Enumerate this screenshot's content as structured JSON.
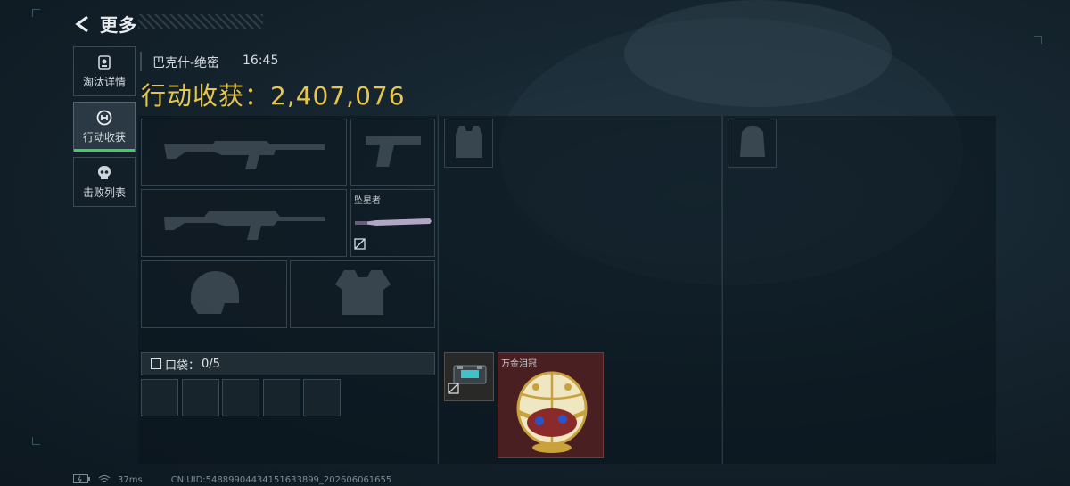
{
  "header": {
    "back_title": "更多"
  },
  "tabs": [
    {
      "label": "淘汰详情",
      "icon": "badge-icon"
    },
    {
      "label": "行动收获",
      "icon": "loot-icon",
      "active": true
    },
    {
      "label": "击败列表",
      "icon": "skull-icon"
    }
  ],
  "match": {
    "map": "巴克什-绝密",
    "time": "16:45"
  },
  "harvest": {
    "label": "行动收获：",
    "value": "2,407,076"
  },
  "loadout": {
    "melee_name": "坠星者"
  },
  "pocket": {
    "label": "口袋：",
    "count": "0/5"
  },
  "backpack_items": {
    "featured_name": "万金泪冠"
  },
  "footer": {
    "ping": "37ms",
    "uid": "CN UID:548899044341516338​99_202606061655"
  },
  "colors": {
    "accent_gold": "#e7c64f",
    "active_tab": "#3ecf5e",
    "item_rare_bg": "#4a1f22"
  }
}
